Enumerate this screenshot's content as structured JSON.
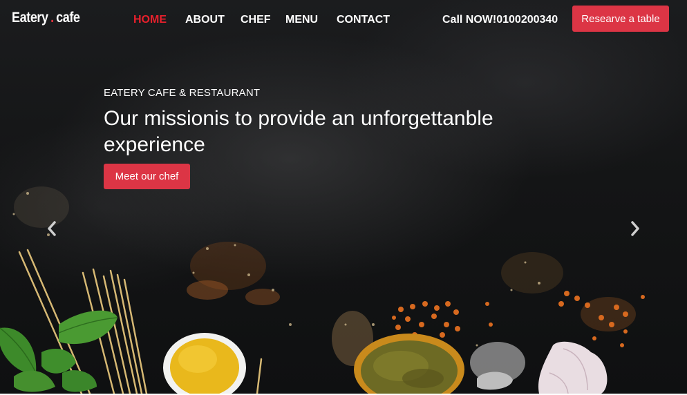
{
  "brand": {
    "logo_part1": "Eatery",
    "logo_dot": ".",
    "logo_part2": "cafe",
    "accent_color": "#dc3545",
    "active_nav_color": "#e8202c"
  },
  "nav": {
    "items": [
      {
        "label": "HOME",
        "active": true
      },
      {
        "label": "ABOUT",
        "active": false
      },
      {
        "label": "CHEF",
        "active": false
      },
      {
        "label": "MENU",
        "active": false
      },
      {
        "label": "CONTACT",
        "active": false
      }
    ],
    "call_text": "Call NOW!0100200340",
    "reserve_label": "Researve a table"
  },
  "hero": {
    "subtitle": "EATERY CAFE & RESTAURANT",
    "headline": "Our missionis to provide an unforgettanble experience",
    "cta_label": "Meet our chef"
  },
  "carousel": {
    "prev_icon": "chevron-left-icon",
    "next_icon": "chevron-right-icon"
  }
}
